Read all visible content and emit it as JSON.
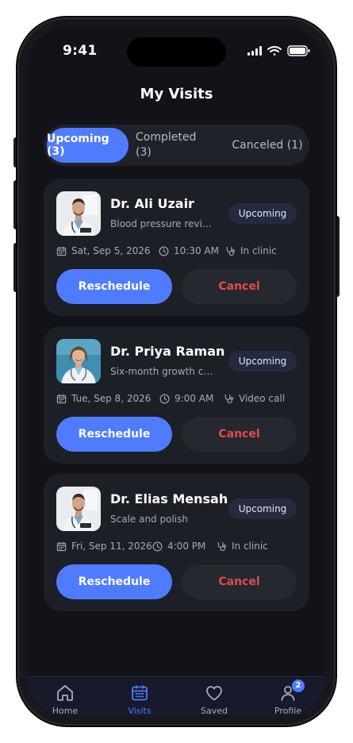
{
  "status_bar": {
    "time": "9:41",
    "icons": [
      "signal-icon",
      "wifi-icon",
      "battery-icon"
    ]
  },
  "page": {
    "title": "My Visits"
  },
  "segments": {
    "upcoming": "Upcoming (3)",
    "completed": "Completed (3)",
    "canceled": "Canceled (1)",
    "selected": "upcoming"
  },
  "visits": [
    {
      "doctor": "Dr. Ali Uzair",
      "reason": "Blood pressure review",
      "status": "Upcoming",
      "date": "Sat, Sep 5, 2026",
      "time": "10:30 AM",
      "mode": "In clinic",
      "reschedule_label": "Reschedule",
      "cancel_label": "Cancel"
    },
    {
      "doctor": "Dr. Priya Raman",
      "reason": "Six-month growth ch...",
      "status": "Upcoming",
      "date": "Tue, Sep 8, 2026",
      "time": "9:00 AM",
      "mode": "Video call",
      "reschedule_label": "Reschedule",
      "cancel_label": "Cancel"
    },
    {
      "doctor": "Dr. Elias Mensah",
      "reason": "Scale and polish",
      "status": "Upcoming",
      "date": "Fri, Sep 11, 2026",
      "time": "4:00 PM",
      "mode": "In clinic",
      "reschedule_label": "Reschedule",
      "cancel_label": "Cancel"
    }
  ],
  "tab_bar": {
    "items": [
      {
        "label": "Home",
        "icon": "home-icon"
      },
      {
        "label": "Visits",
        "icon": "calendar-icon",
        "active": true
      },
      {
        "label": "Saved",
        "icon": "heart-icon"
      },
      {
        "label": "Profile",
        "icon": "user-icon",
        "badge": "2"
      }
    ]
  },
  "colors": {
    "accent": "#4f7cff",
    "background": "#121318",
    "card": "#1d1f27",
    "danger": "#e24b4b",
    "badge_bg": "#262a40"
  }
}
